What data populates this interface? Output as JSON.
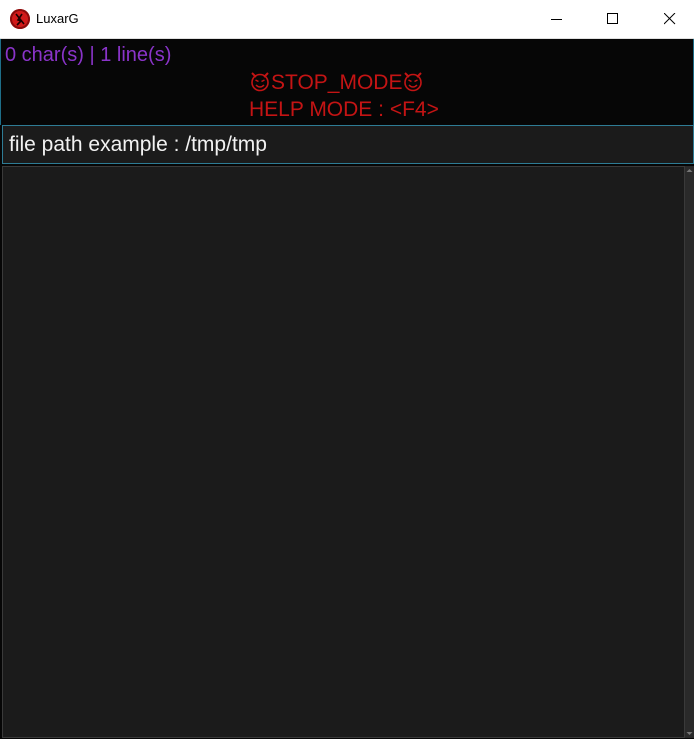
{
  "window": {
    "title": "LuxarG",
    "app_icon": "luxarg-app-icon",
    "controls": {
      "minimize": "minimize-icon",
      "maximize": "maximize-icon",
      "close": "close-icon"
    }
  },
  "status": {
    "counter": "0 char(s) | 1 line(s)",
    "mode": "STOP_MODE",
    "mode_icon": "smiling-devil-icon",
    "help": "HELP MODE : <F4>"
  },
  "file_path": {
    "placeholder": "file path example : /tmp/tmp",
    "value": ""
  },
  "editor": {
    "content": ""
  },
  "colors": {
    "counter_text": "#8a34c9",
    "mode_text": "#c41414",
    "background": "#060606",
    "editor_background": "#1b1b1b",
    "accent_border": "#2e7c95"
  }
}
